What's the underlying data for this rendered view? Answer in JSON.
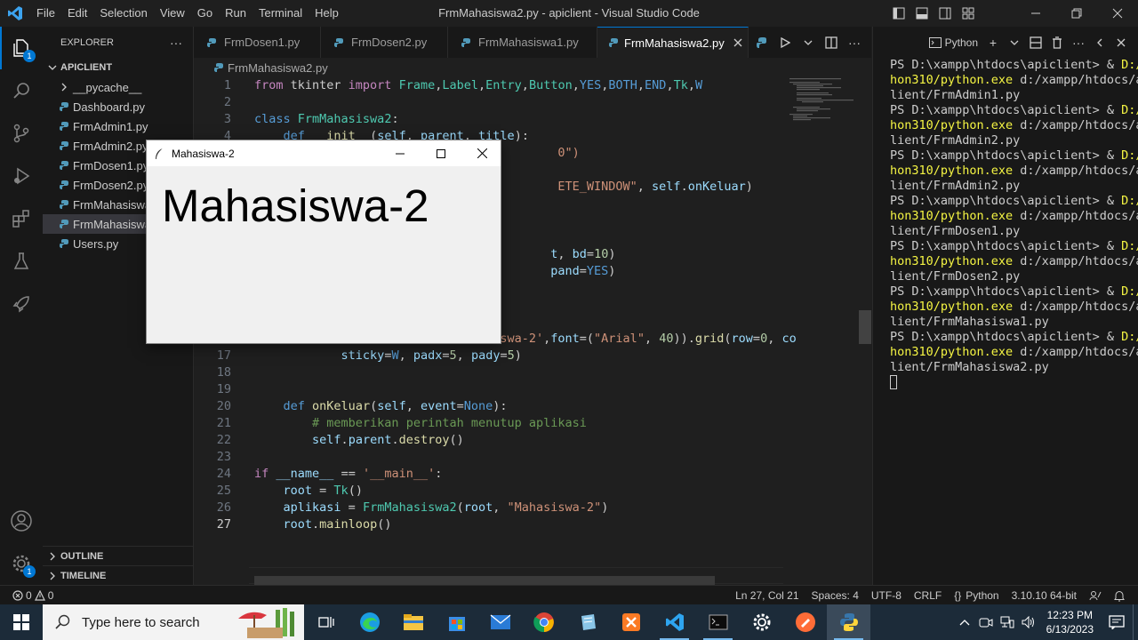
{
  "window": {
    "title": "FrmMahasiswa2.py - apiclient - Visual Studio Code",
    "menu": [
      "File",
      "Edit",
      "Selection",
      "View",
      "Go",
      "Run",
      "Terminal",
      "Help"
    ]
  },
  "activity": {
    "explorer_badge": "1",
    "settings_badge": "1"
  },
  "sidebar": {
    "header": "EXPLORER",
    "more": "···",
    "root": "APICLIENT",
    "items": [
      {
        "label": "__pycache__",
        "type": "folder"
      },
      {
        "label": "Dashboard.py",
        "type": "py"
      },
      {
        "label": "FrmAdmin1.py",
        "type": "py"
      },
      {
        "label": "FrmAdmin2.py",
        "type": "py"
      },
      {
        "label": "FrmDosen1.py",
        "type": "py"
      },
      {
        "label": "FrmDosen2.py",
        "type": "py"
      },
      {
        "label": "FrmMahasiswa1.py",
        "type": "py"
      },
      {
        "label": "FrmMahasiswa2.py",
        "type": "py",
        "selected": true
      },
      {
        "label": "Users.py",
        "type": "py"
      }
    ],
    "outline": "OUTLINE",
    "timeline": "TIMELINE"
  },
  "tabs": [
    {
      "label": "FrmDosen1.py"
    },
    {
      "label": "FrmDosen2.py"
    },
    {
      "label": "FrmMahasiswa1.py"
    },
    {
      "label": "FrmMahasiswa2.py",
      "active": true
    }
  ],
  "breadcrumb": "FrmMahasiswa2.py",
  "code": {
    "current_line": 27,
    "lines": [
      {
        "n": 1,
        "html": "<span class=\"kw2\">from</span> tkinter <span class=\"kw2\">import</span> <span class=\"cls\">Frame</span>,<span class=\"cls\">Label</span>,<span class=\"cls\">Entry</span>,<span class=\"cls\">Button</span>,<span class=\"kw\">YES</span>,<span class=\"kw\">BOTH</span>,<span class=\"kw\">END</span>,<span class=\"cls\">Tk</span>,<span class=\"kw\">W</span>"
      },
      {
        "n": 2,
        "html": ""
      },
      {
        "n": 3,
        "html": "<span class=\"kw\">class</span> <span class=\"cls\">FrmMahasiswa2</span>:"
      },
      {
        "n": 4,
        "html": "    <span class=\"kw\">def</span> <span class=\"fn\">__init__</span>(<span class=\"var\">self</span>, <span class=\"var\">parent</span>, <span class=\"var\">title</span>):"
      },
      {
        "n": 5,
        "html": "                                          <span class=\"str\">0\")</span>"
      },
      {
        "n": 6,
        "html": ""
      },
      {
        "n": 7,
        "html": "                                          <span class=\"str\">ETE_WINDOW\"</span>, <span class=\"var\">self</span>.<span class=\"var\">onKeluar</span>)"
      },
      {
        "n": 8,
        "html": ""
      },
      {
        "n": 9,
        "html": ""
      },
      {
        "n": 10,
        "html": ""
      },
      {
        "n": 11,
        "html": "                                         <span class=\"var\">t</span>, <span class=\"var\">bd</span>=<span class=\"num\">10</span>)"
      },
      {
        "n": 12,
        "html": "                                         <span class=\"var\">pand</span>=<span class=\"kw\">YES</span>)"
      },
      {
        "n": 13,
        "html": ""
      },
      {
        "n": 14,
        "html": ""
      },
      {
        "n": 15,
        "html": ""
      },
      {
        "n": 16,
        "html": "                                 <span class=\"str\">iswa-2'</span>,<span class=\"var\">font</span>=(<span class=\"str\">\"Arial\"</span>, <span class=\"num\">40</span>)).<span class=\"fn\">grid</span>(<span class=\"var\">row</span>=<span class=\"num\">0</span>, <span class=\"var\">co</span>"
      },
      {
        "n": 17,
        "html": "            <span class=\"var\">sticky</span>=<span class=\"kw\">W</span>, <span class=\"var\">padx</span>=<span class=\"num\">5</span>, <span class=\"var\">pady</span>=<span class=\"num\">5</span>)"
      },
      {
        "n": 18,
        "html": ""
      },
      {
        "n": 19,
        "html": ""
      },
      {
        "n": 20,
        "html": "    <span class=\"kw\">def</span> <span class=\"fn\">onKeluar</span>(<span class=\"var\">self</span>, <span class=\"var\">event</span>=<span class=\"kw\">None</span>):"
      },
      {
        "n": 21,
        "html": "        <span class=\"cmt\"># memberikan perintah menutup aplikasi</span>"
      },
      {
        "n": 22,
        "html": "        <span class=\"var\">self</span>.<span class=\"var\">parent</span>.<span class=\"fn\">destroy</span>()"
      },
      {
        "n": 23,
        "html": ""
      },
      {
        "n": 24,
        "html": "<span class=\"kw2\">if</span> <span class=\"var\">__name__</span> == <span class=\"str\">'__main__'</span>:"
      },
      {
        "n": 25,
        "html": "    <span class=\"var\">root</span> = <span class=\"cls\">Tk</span>()"
      },
      {
        "n": 26,
        "html": "    <span class=\"var\">aplikasi</span> = <span class=\"cls\">FrmMahasiswa2</span>(<span class=\"var\">root</span>, <span class=\"str\">\"Mahasiswa-2\"</span>)"
      },
      {
        "n": 27,
        "html": "    <span class=\"var\">root</span>.<span class=\"fn\">mainloop</span>()"
      }
    ]
  },
  "terminal": {
    "shell": "Python",
    "lines": [
      [
        "PS D:\\xampp\\htdocs\\apiclient> & ",
        "D:/Pyt",
        ""
      ],
      [
        "",
        "hon310/python.exe",
        " d:/xampp/htdocs/apic"
      ],
      [
        "lient/FrmAdmin1.py",
        "",
        ""
      ],
      [
        "PS D:\\xampp\\htdocs\\apiclient> & ",
        "D:/Pyt",
        ""
      ],
      [
        "",
        "hon310/python.exe",
        " d:/xampp/htdocs/apic"
      ],
      [
        "lient/FrmAdmin2.py",
        "",
        ""
      ],
      [
        "PS D:\\xampp\\htdocs\\apiclient> & ",
        "D:/Pyt",
        ""
      ],
      [
        "",
        "hon310/python.exe",
        " d:/xampp/htdocs/apic"
      ],
      [
        "lient/FrmAdmin2.py",
        "",
        ""
      ],
      [
        "PS D:\\xampp\\htdocs\\apiclient> & ",
        "D:/Pyt",
        ""
      ],
      [
        "",
        "hon310/python.exe",
        " d:/xampp/htdocs/apic"
      ],
      [
        "lient/FrmDosen1.py",
        "",
        ""
      ],
      [
        "PS D:\\xampp\\htdocs\\apiclient> & ",
        "D:/Pyt",
        ""
      ],
      [
        "",
        "hon310/python.exe",
        " d:/xampp/htdocs/apic"
      ],
      [
        "lient/FrmDosen2.py",
        "",
        ""
      ],
      [
        "PS D:\\xampp\\htdocs\\apiclient> & ",
        "D:/Pyt",
        ""
      ],
      [
        "",
        "hon310/python.exe",
        " d:/xampp/htdocs/apic"
      ],
      [
        "lient/FrmMahasiswa1.py",
        "",
        ""
      ],
      [
        "PS D:\\xampp\\htdocs\\apiclient> & ",
        "D:/Pyt",
        ""
      ],
      [
        "",
        "hon310/python.exe",
        " d:/xampp/htdocs/apic"
      ],
      [
        "lient/FrmMahasiswa2.py",
        "",
        ""
      ]
    ]
  },
  "status": {
    "problems": "0",
    "warnings": "0",
    "position": "Ln 27, Col 21",
    "spaces": "Spaces: 4",
    "encoding": "UTF-8",
    "eol": "CRLF",
    "language": "Python",
    "interpreter": "3.10.10 64-bit"
  },
  "taskbar": {
    "search_placeholder": "Type here to search",
    "time": "12:23 PM",
    "date": "6/13/2023"
  },
  "tk_window": {
    "title": "Mahasiswa-2",
    "label": "Mahasiswa-2"
  }
}
